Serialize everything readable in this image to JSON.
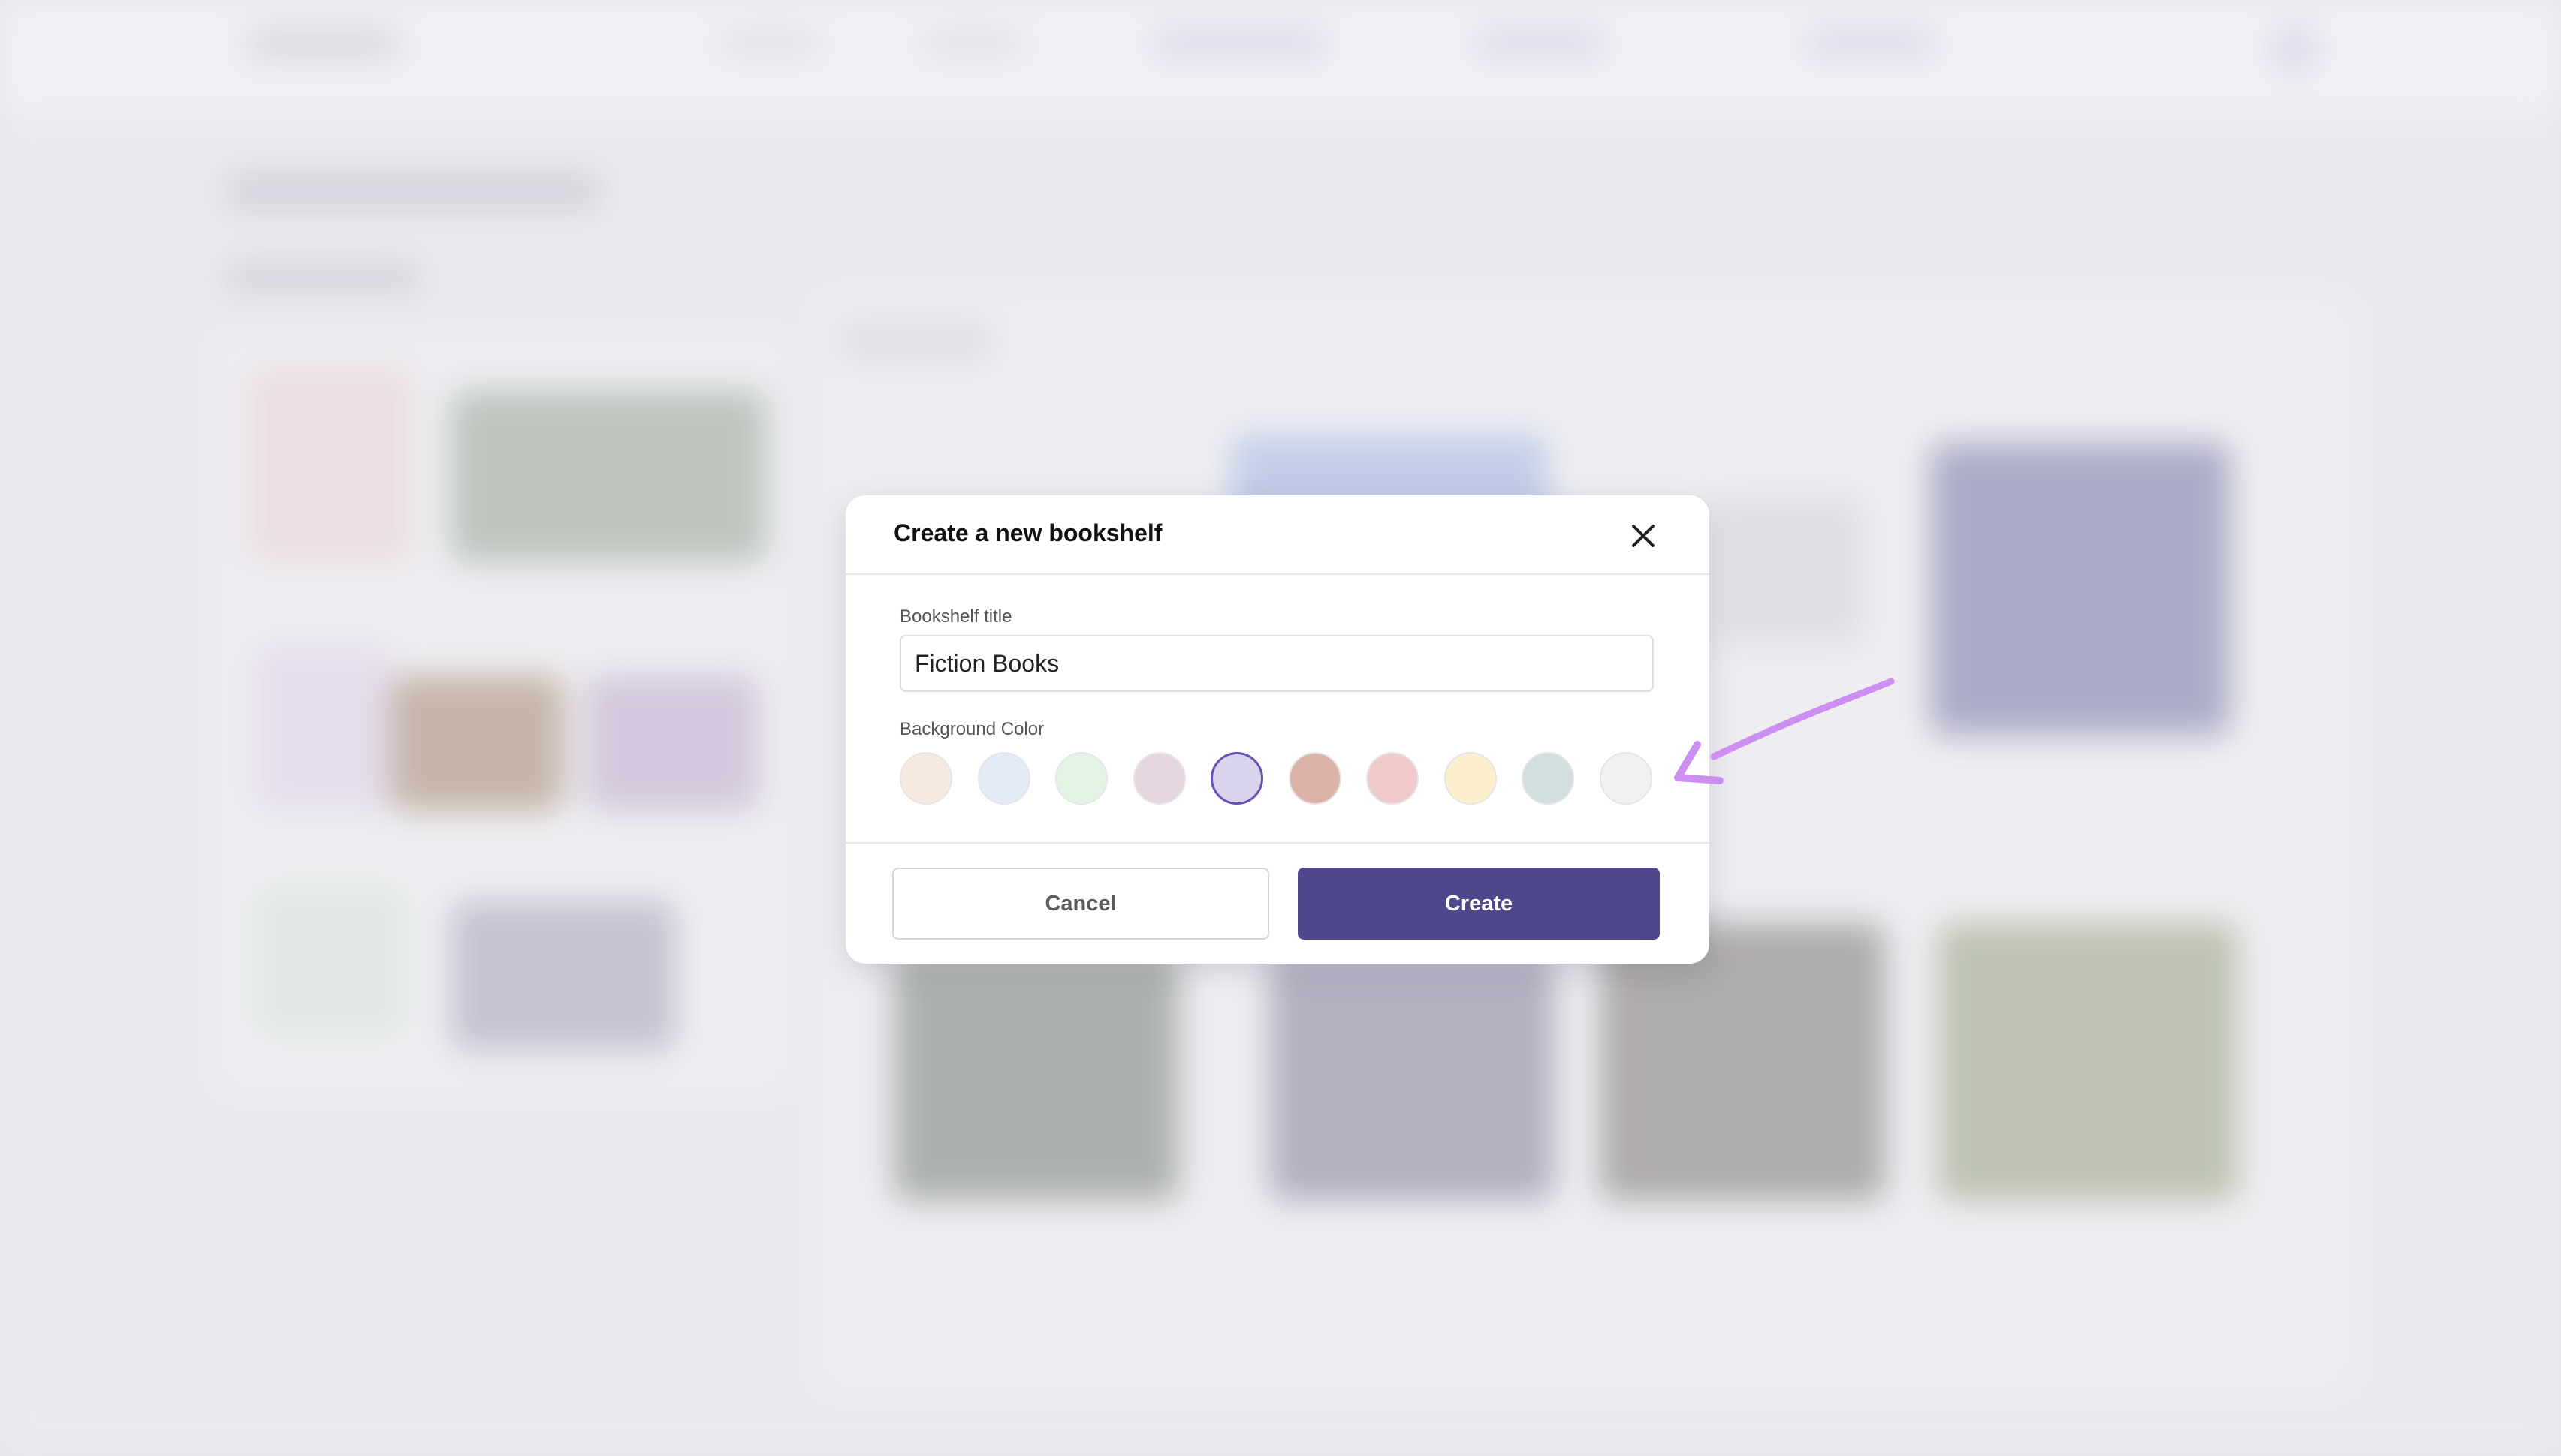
{
  "modal": {
    "title": "Create a new bookshelf",
    "close_icon": "close-icon",
    "title_field": {
      "label": "Bookshelf title",
      "value": "Fiction Books",
      "placeholder": ""
    },
    "color_field": {
      "label": "Background Color",
      "selected_index": 4,
      "swatches": [
        "#f6e9e0",
        "#e3eaf8",
        "#e3f4e7",
        "#e7d6df",
        "#d9d3ec",
        "#dcb2a6",
        "#efcaca",
        "#fbf0cb",
        "#d3dee0",
        "#f1f1f2"
      ]
    },
    "cancel_label": "Cancel",
    "create_label": "Create"
  },
  "colors": {
    "accent": "#4f478b",
    "selected_ring": "#6b4fb3",
    "annotation_arrow": "#cc8ef0"
  }
}
